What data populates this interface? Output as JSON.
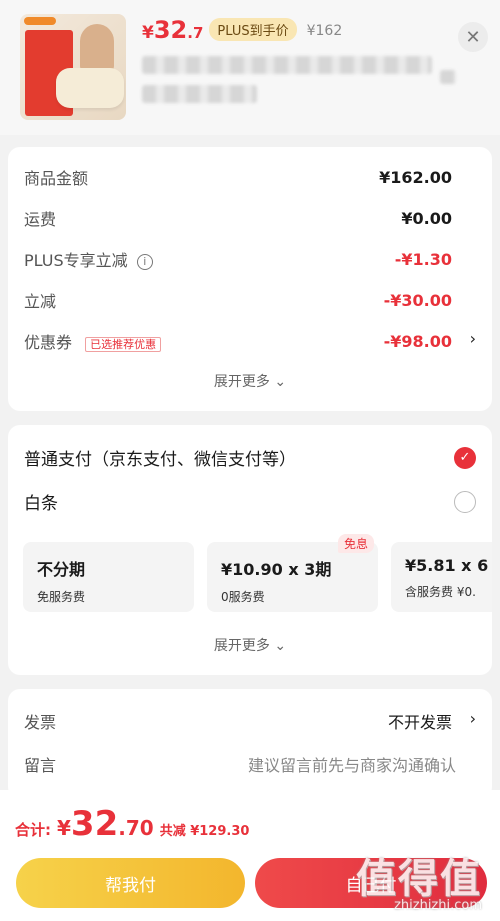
{
  "product": {
    "price_yen": "¥",
    "price_int": "32",
    "price_dec": ".7",
    "plus_tag": "PLUS到手价",
    "original_price": "¥162"
  },
  "summary": {
    "rows": [
      {
        "label": "商品金额",
        "value": "¥162.00"
      },
      {
        "label": "运费",
        "value": "¥0.00"
      },
      {
        "label": "PLUS专享立减",
        "value": "-¥1.30"
      },
      {
        "label": "立减",
        "value": "-¥30.00"
      },
      {
        "label": "优惠券",
        "value": "-¥98.00",
        "tag": "已选推荐优惠"
      }
    ],
    "expand_label": "展开更多"
  },
  "payment": {
    "methods": [
      {
        "label": "普通支付（京东支付、微信支付等）",
        "selected": true
      },
      {
        "label": "白条",
        "selected": false
      }
    ],
    "installments": [
      {
        "title": "不分期",
        "sub": "免服务费"
      },
      {
        "title": "¥10.90 x 3期",
        "sub": "0服务费",
        "tag": "免息"
      },
      {
        "title": "¥5.81 x 6",
        "sub": "含服务费 ¥0."
      }
    ],
    "expand_label": "展开更多"
  },
  "extras": {
    "invoice_label": "发票",
    "invoice_value": "不开发票",
    "message_label": "留言",
    "message_placeholder": "建议留言前先与商家沟通确认"
  },
  "footer": {
    "total_label": "合计:",
    "total_yen": "¥",
    "total_int": "32",
    "total_dec": ".70",
    "savings": "共减 ¥129.30",
    "help_pay_label": "帮我付",
    "self_pay_label": "自己付"
  },
  "watermark": {
    "text": "值得值",
    "url": "zhizhizhi.com"
  },
  "colors": {
    "accent_red": "#e8313a",
    "plus_gold": "#f9e6b3",
    "help_button": "#f3b62d"
  }
}
